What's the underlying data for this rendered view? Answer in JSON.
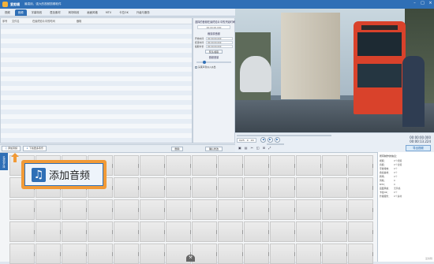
{
  "titlebar": {
    "app": "爱剪辑",
    "subtitle": "最易用、强大的视频剪辑软件"
  },
  "tabs": [
    {
      "label": "视频",
      "active": false
    },
    {
      "label": "音频",
      "active": true
    },
    {
      "label": "字幕特效",
      "active": false
    },
    {
      "label": "叠加素材",
      "active": false
    },
    {
      "label": "转场特效",
      "active": false
    },
    {
      "label": "画面风格",
      "active": false
    },
    {
      "label": "MTV",
      "active": false
    },
    {
      "label": "卡拉OK",
      "active": false
    },
    {
      "label": "升级与服务",
      "active": false
    }
  ],
  "list": {
    "columns": [
      "序号",
      "文件名",
      "在最终影片中的时间",
      "截取"
    ]
  },
  "side": {
    "header": "选择的音频在最终影片中的开始时间",
    "start_time": "00:00:00.000",
    "clip_header": "裁剪原音频",
    "rows": [
      {
        "label": "开始时间",
        "value": "00:00:00.000"
      },
      {
        "label": "结束时间",
        "value": "00:00:00.000"
      },
      {
        "label": "截取时长",
        "value": "00:00:00.000"
      }
    ],
    "preview_btn": "预览/截取",
    "effect_header": "音频音量",
    "check_label": "头尾声音淡入淡出"
  },
  "actionbar": {
    "add_audio": "添加音频",
    "download_music": "下载更多音乐",
    "delete": "删除",
    "confirm": "确认修改"
  },
  "controls": {
    "progress": 0.0,
    "time_display": [
      "0/25",
      "0",
      "29"
    ],
    "current_time": "00:00:00.000",
    "total_time": "00:00:13.224",
    "export_label": "导出视频",
    "tools": [
      "▣",
      "▤",
      "✂",
      "◱",
      "⊞",
      "⤢"
    ]
  },
  "timeline": {
    "tab_label": "已添加片段",
    "cells": 70,
    "handle": "⚒"
  },
  "info": {
    "header": "所有制作的信息：",
    "rows": [
      {
        "k": "视频：",
        "v": "0个视频"
      },
      {
        "k": "音频：",
        "v": "0个音频"
      },
      {
        "k": "字幕特效：",
        "v": "0个"
      },
      {
        "k": "叠加素材：",
        "v": "0个"
      },
      {
        "k": "转场：",
        "v": "0个"
      },
      {
        "k": "风格：",
        "v": "0"
      },
      {
        "k": "MTV：",
        "v": "0"
      },
      {
        "k": "画面风格：",
        "v": "无风格"
      },
      {
        "k": "卡拉OK：",
        "v": "0个"
      },
      {
        "k": "升级服务：",
        "v": "0个素材"
      }
    ],
    "watermark": "爱剪辑"
  },
  "callout": {
    "label": "添加音频",
    "icon": "music-note-icon"
  },
  "colors": {
    "accent": "#2f6fb6",
    "highlight": "#f19a37"
  }
}
